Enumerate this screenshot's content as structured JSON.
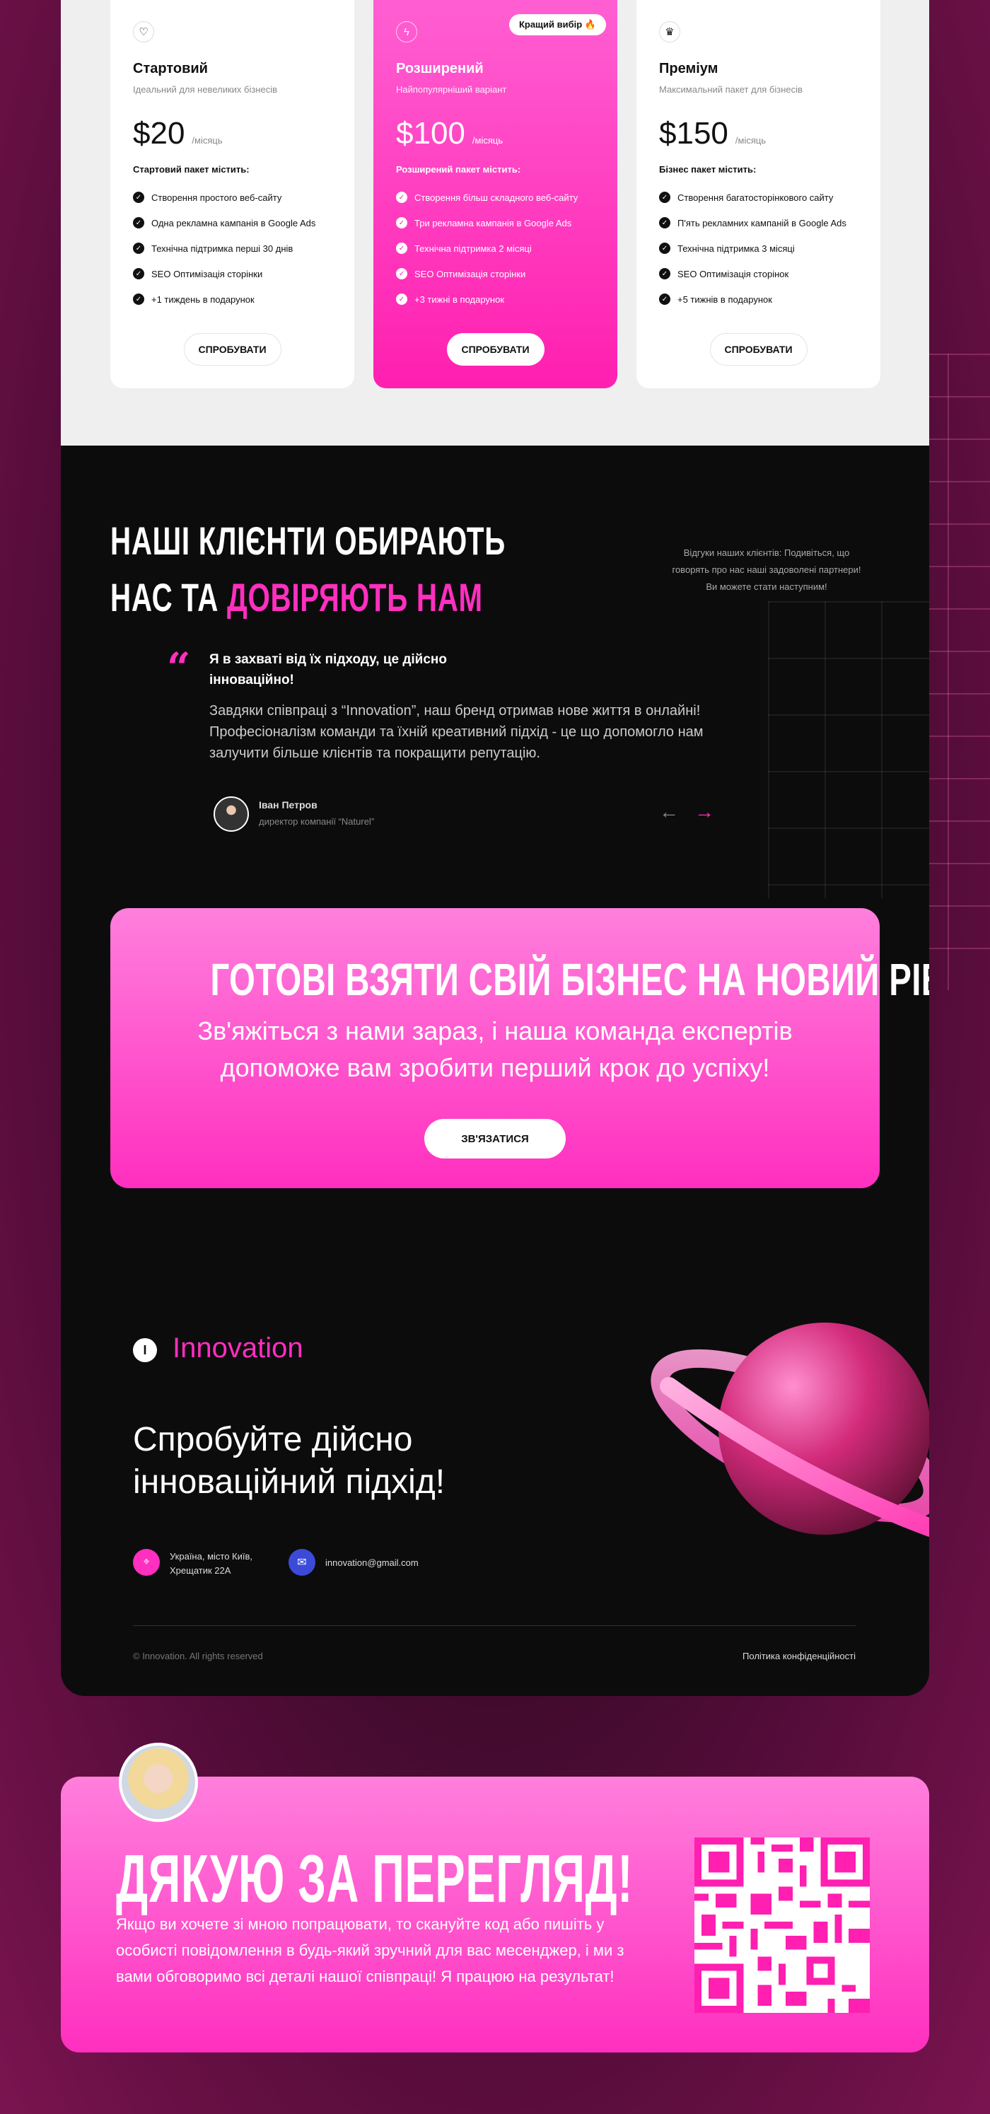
{
  "pricing": {
    "plans": [
      {
        "icon": "heart-icon",
        "name": "Стартовий",
        "desc": "Ідеальний для невеликих бізнесів",
        "price": "$20",
        "period": "/місяць",
        "includes": "Стартовий пакет містить:",
        "features": [
          "Створення простого веб-сайту",
          "Одна рекламна кампанія в Google Ads",
          "Технічна підтримка перші 30 днів",
          "SEO Оптимізація сторінки",
          "+1 тиждень в подарунок"
        ],
        "button": "СПРОБУВАТИ"
      },
      {
        "icon": "lightning-icon",
        "name": "Розширений",
        "desc": "Найпопулярніший варіант",
        "price": "$100",
        "period": "/місяць",
        "includes": "Розширений пакет містить:",
        "features": [
          "Створення більш складного веб-сайту",
          "Три рекламна кампанія в Google Ads",
          "Технічна підтримка 2 місяці",
          "SEO Оптимізація сторінки",
          "+3 тижні в подарунок"
        ],
        "button": "СПРОБУВАТИ",
        "badge": "Кращий вибір 🔥"
      },
      {
        "icon": "crown-icon",
        "name": "Преміум",
        "desc": "Максимальний пакет для бізнесів",
        "price": "$150",
        "period": "/місяць",
        "includes": "Бізнес пакет містить:",
        "features": [
          "Створення багатосторінкового сайту",
          "П'ять рекламних кампаній в Google Ads",
          "Технічна підтримка 3 місяці",
          "SEO Оптимізація сторінок",
          "+5 тижнів в подарунок"
        ],
        "button": "СПРОБУВАТИ"
      }
    ]
  },
  "clients": {
    "title_line1": "НАШІ КЛІЄНТИ ОБИРАЮТЬ",
    "title_line2_white": "НАС ТА ",
    "title_line2_pink": "ДОВІРЯЮТЬ НАМ",
    "side_text": "Відгуки наших клієнтів: Подивіться, що говорять про нас наші задоволені партнери! Ви можете стати наступним!",
    "quote_mark": "“",
    "quote_head": "Я в захваті від їх підходу, це дійсно інноваційно!",
    "quote_body": "Завдяки співпраці з “Innovation”, наш бренд отримав нове життя в онлайні! Професіоналізм команди та їхній креативний підхід - це що допомогло нам залучити більше клієнтів та покращити репутацію.",
    "author_name": "Іван Петров",
    "author_role": "директор компанії “Naturel”",
    "prev_arrow": "←",
    "next_arrow": "→"
  },
  "cta": {
    "title": "ГОТОВІ ВЗЯТИ СВІЙ БІЗНЕС НА НОВИЙ РІВЕНЬ?",
    "subtitle": "Зв'яжіться з нами зараз, і наша команда експертів допоможе вам зробити перший крок до успіху!",
    "button": "ЗВ'ЯЗАТИСЯ"
  },
  "footer": {
    "logo_letter": "I",
    "logo_text": "Innovation",
    "title_line1": "Спробуйте дійсно",
    "title_line2": "інноваційний підхід!",
    "address_line1": "Україна, місто Київ,",
    "address_line2": "Хрещатик 22А",
    "email": "innovation@gmail.com",
    "copyright": "© Innovation. All rights reserved",
    "privacy": "Політика конфіденційності"
  },
  "thanks": {
    "title": "ДЯКУЮ ЗА ПЕРЕГЛЯД!",
    "text": "Якщо ви хочете зі мною попрацювати, то скануйте код або пишіть  у особисті повідомлення в будь-який зручний для вас месенджер, і ми з вами обговоримо всі деталі нашої співпраці! Я працюю на результат!"
  },
  "colors": {
    "accent": "#ff2fbf",
    "dark": "#0d0c0d",
    "light_panel": "#efefef"
  }
}
